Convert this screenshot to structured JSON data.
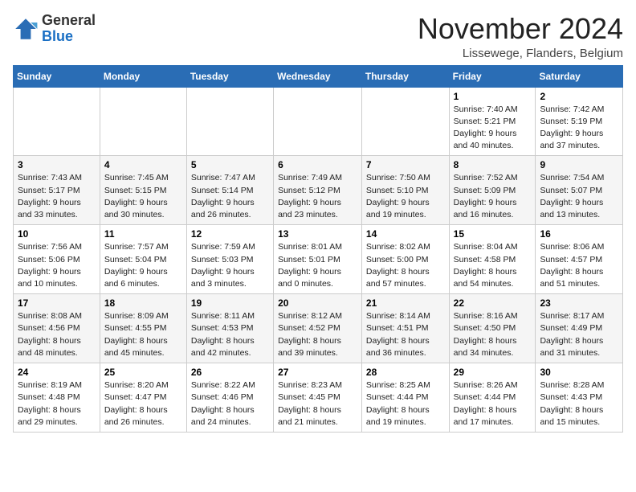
{
  "logo": {
    "general": "General",
    "blue": "Blue"
  },
  "header": {
    "month": "November 2024",
    "location": "Lissewege, Flanders, Belgium"
  },
  "weekdays": [
    "Sunday",
    "Monday",
    "Tuesday",
    "Wednesday",
    "Thursday",
    "Friday",
    "Saturday"
  ],
  "weeks": [
    [
      {
        "day": "",
        "info": ""
      },
      {
        "day": "",
        "info": ""
      },
      {
        "day": "",
        "info": ""
      },
      {
        "day": "",
        "info": ""
      },
      {
        "day": "",
        "info": ""
      },
      {
        "day": "1",
        "info": "Sunrise: 7:40 AM\nSunset: 5:21 PM\nDaylight: 9 hours and 40 minutes."
      },
      {
        "day": "2",
        "info": "Sunrise: 7:42 AM\nSunset: 5:19 PM\nDaylight: 9 hours and 37 minutes."
      }
    ],
    [
      {
        "day": "3",
        "info": "Sunrise: 7:43 AM\nSunset: 5:17 PM\nDaylight: 9 hours and 33 minutes."
      },
      {
        "day": "4",
        "info": "Sunrise: 7:45 AM\nSunset: 5:15 PM\nDaylight: 9 hours and 30 minutes."
      },
      {
        "day": "5",
        "info": "Sunrise: 7:47 AM\nSunset: 5:14 PM\nDaylight: 9 hours and 26 minutes."
      },
      {
        "day": "6",
        "info": "Sunrise: 7:49 AM\nSunset: 5:12 PM\nDaylight: 9 hours and 23 minutes."
      },
      {
        "day": "7",
        "info": "Sunrise: 7:50 AM\nSunset: 5:10 PM\nDaylight: 9 hours and 19 minutes."
      },
      {
        "day": "8",
        "info": "Sunrise: 7:52 AM\nSunset: 5:09 PM\nDaylight: 9 hours and 16 minutes."
      },
      {
        "day": "9",
        "info": "Sunrise: 7:54 AM\nSunset: 5:07 PM\nDaylight: 9 hours and 13 minutes."
      }
    ],
    [
      {
        "day": "10",
        "info": "Sunrise: 7:56 AM\nSunset: 5:06 PM\nDaylight: 9 hours and 10 minutes."
      },
      {
        "day": "11",
        "info": "Sunrise: 7:57 AM\nSunset: 5:04 PM\nDaylight: 9 hours and 6 minutes."
      },
      {
        "day": "12",
        "info": "Sunrise: 7:59 AM\nSunset: 5:03 PM\nDaylight: 9 hours and 3 minutes."
      },
      {
        "day": "13",
        "info": "Sunrise: 8:01 AM\nSunset: 5:01 PM\nDaylight: 9 hours and 0 minutes."
      },
      {
        "day": "14",
        "info": "Sunrise: 8:02 AM\nSunset: 5:00 PM\nDaylight: 8 hours and 57 minutes."
      },
      {
        "day": "15",
        "info": "Sunrise: 8:04 AM\nSunset: 4:58 PM\nDaylight: 8 hours and 54 minutes."
      },
      {
        "day": "16",
        "info": "Sunrise: 8:06 AM\nSunset: 4:57 PM\nDaylight: 8 hours and 51 minutes."
      }
    ],
    [
      {
        "day": "17",
        "info": "Sunrise: 8:08 AM\nSunset: 4:56 PM\nDaylight: 8 hours and 48 minutes."
      },
      {
        "day": "18",
        "info": "Sunrise: 8:09 AM\nSunset: 4:55 PM\nDaylight: 8 hours and 45 minutes."
      },
      {
        "day": "19",
        "info": "Sunrise: 8:11 AM\nSunset: 4:53 PM\nDaylight: 8 hours and 42 minutes."
      },
      {
        "day": "20",
        "info": "Sunrise: 8:12 AM\nSunset: 4:52 PM\nDaylight: 8 hours and 39 minutes."
      },
      {
        "day": "21",
        "info": "Sunrise: 8:14 AM\nSunset: 4:51 PM\nDaylight: 8 hours and 36 minutes."
      },
      {
        "day": "22",
        "info": "Sunrise: 8:16 AM\nSunset: 4:50 PM\nDaylight: 8 hours and 34 minutes."
      },
      {
        "day": "23",
        "info": "Sunrise: 8:17 AM\nSunset: 4:49 PM\nDaylight: 8 hours and 31 minutes."
      }
    ],
    [
      {
        "day": "24",
        "info": "Sunrise: 8:19 AM\nSunset: 4:48 PM\nDaylight: 8 hours and 29 minutes."
      },
      {
        "day": "25",
        "info": "Sunrise: 8:20 AM\nSunset: 4:47 PM\nDaylight: 8 hours and 26 minutes."
      },
      {
        "day": "26",
        "info": "Sunrise: 8:22 AM\nSunset: 4:46 PM\nDaylight: 8 hours and 24 minutes."
      },
      {
        "day": "27",
        "info": "Sunrise: 8:23 AM\nSunset: 4:45 PM\nDaylight: 8 hours and 21 minutes."
      },
      {
        "day": "28",
        "info": "Sunrise: 8:25 AM\nSunset: 4:44 PM\nDaylight: 8 hours and 19 minutes."
      },
      {
        "day": "29",
        "info": "Sunrise: 8:26 AM\nSunset: 4:44 PM\nDaylight: 8 hours and 17 minutes."
      },
      {
        "day": "30",
        "info": "Sunrise: 8:28 AM\nSunset: 4:43 PM\nDaylight: 8 hours and 15 minutes."
      }
    ]
  ]
}
